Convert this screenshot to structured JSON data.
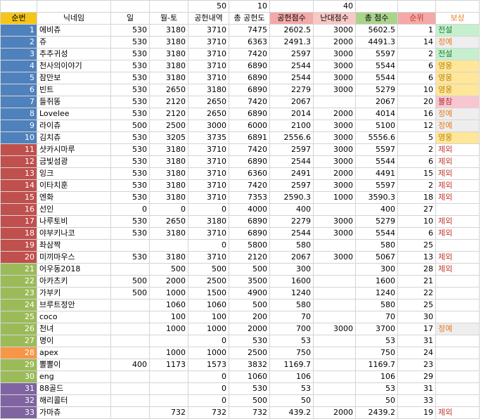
{
  "top_row": [
    "",
    "",
    "",
    "",
    "50",
    "10",
    "",
    "40",
    "",
    "",
    ""
  ],
  "headers": [
    "순번",
    "닉네임",
    "일",
    "월-토",
    "공헌내역",
    "총 공헌도",
    "공헌점수",
    "난대점수",
    "총 점수",
    "순위",
    "보상"
  ],
  "header_colors": [
    "#f5c518",
    "#ffffff",
    "#ffffff",
    "#ffffff",
    "#ffffff",
    "#ffffff",
    "#f4a9a8",
    "#f9c8c4",
    "#a9d48a",
    "#f4a9a8",
    "#ffffff"
  ],
  "header_text_colors": [
    "#000000",
    "#000000",
    "#000000",
    "#000000",
    "#000000",
    "#000000",
    "#000000",
    "#000000",
    "#000000",
    "#c0392b",
    "#e67e22"
  ],
  "rows": [
    {
      "idx": "1",
      "name": "에비츄",
      "c": [
        "530",
        "3180",
        "3710",
        "7475",
        "2602.5",
        "3000",
        "5602.5",
        "1"
      ],
      "reward": "전설",
      "rc": "green",
      "rb": "#c6efce",
      "ic": "#4f81bd"
    },
    {
      "idx": "2",
      "name": "쥬",
      "c": [
        "530",
        "3180",
        "3710",
        "6363",
        "2491.3",
        "2000",
        "4491.3",
        "14"
      ],
      "reward": "정예",
      "rc": "orange",
      "rb": "#eeeeee",
      "ic": "#4f81bd"
    },
    {
      "idx": "3",
      "name": "추추귀성",
      "c": [
        "530",
        "3180",
        "3710",
        "7420",
        "2597",
        "3000",
        "5597",
        "2"
      ],
      "reward": "전설",
      "rc": "green",
      "rb": "#c6efce",
      "ic": "#4f81bd"
    },
    {
      "idx": "4",
      "name": "천사의이야기",
      "c": [
        "530",
        "3180",
        "3710",
        "6890",
        "2544",
        "3000",
        "5544",
        "6"
      ],
      "reward": "영웅",
      "rc": "gold",
      "rb": "#ffe699",
      "ic": "#4f81bd"
    },
    {
      "idx": "5",
      "name": "잠만보",
      "c": [
        "530",
        "3180",
        "3710",
        "6890",
        "2544",
        "3000",
        "5544",
        "6"
      ],
      "reward": "영웅",
      "rc": "gold",
      "rb": "#ffe699",
      "ic": "#4f81bd"
    },
    {
      "idx": "6",
      "name": "빈트",
      "c": [
        "530",
        "2650",
        "3180",
        "6890",
        "2279",
        "3000",
        "5279",
        "10"
      ],
      "reward": "영웅",
      "rc": "gold",
      "rb": "#ffe699",
      "ic": "#4f81bd"
    },
    {
      "idx": "7",
      "name": "들쥐똥",
      "c": [
        "530",
        "2120",
        "2650",
        "7420",
        "2067",
        "",
        "2067",
        "20"
      ],
      "reward": "불참",
      "rc": "dark",
      "rb": "#f8c6d0",
      "ic": "#4f81bd"
    },
    {
      "idx": "8",
      "name": "Lovelee",
      "c": [
        "530",
        "2120",
        "2650",
        "6890",
        "2014",
        "2000",
        "4014",
        "16"
      ],
      "reward": "정예",
      "rc": "orange",
      "rb": "#eeeeee",
      "ic": "#4f81bd"
    },
    {
      "idx": "9",
      "name": "라이츄",
      "c": [
        "500",
        "2500",
        "3000",
        "6000",
        "2100",
        "3000",
        "5100",
        "12"
      ],
      "reward": "정예",
      "rc": "orange",
      "rb": "#eeeeee",
      "ic": "#4f81bd"
    },
    {
      "idx": "10",
      "name": "김치츄",
      "c": [
        "530",
        "3205",
        "3735",
        "6891",
        "2556.6",
        "3000",
        "5556.6",
        "5"
      ],
      "reward": "영웅",
      "rc": "gold",
      "rb": "#ffe699",
      "ic": "#4f81bd"
    },
    {
      "idx": "11",
      "name": "샷카시마루",
      "c": [
        "530",
        "3180",
        "3710",
        "7420",
        "2597",
        "3000",
        "5597",
        "2"
      ],
      "reward": "제외",
      "rc": "red",
      "rb": "#ffffff",
      "ic": "#c0504d"
    },
    {
      "idx": "12",
      "name": "금빛섬광",
      "c": [
        "530",
        "3180",
        "3710",
        "6890",
        "2544",
        "3000",
        "5544",
        "6"
      ],
      "reward": "제외",
      "rc": "red",
      "rb": "#ffffff",
      "ic": "#c0504d"
    },
    {
      "idx": "13",
      "name": "잉크",
      "c": [
        "530",
        "3180",
        "3710",
        "6360",
        "2491",
        "2000",
        "4491",
        "15"
      ],
      "reward": "제외",
      "rc": "red",
      "rb": "#ffffff",
      "ic": "#c0504d"
    },
    {
      "idx": "14",
      "name": "이타치훈",
      "c": [
        "530",
        "3180",
        "3710",
        "7420",
        "2597",
        "3000",
        "5597",
        "2"
      ],
      "reward": "제외",
      "rc": "red",
      "rb": "#ffffff",
      "ic": "#c0504d"
    },
    {
      "idx": "15",
      "name": "엔화",
      "c": [
        "530",
        "3180",
        "3710",
        "7353",
        "2590.3",
        "1000",
        "3590.3",
        "18"
      ],
      "reward": "제외",
      "rc": "red",
      "rb": "#ffffff",
      "ic": "#c0504d"
    },
    {
      "idx": "16",
      "name": "선인",
      "c": [
        "0",
        "0",
        "0",
        "4000",
        "400",
        "",
        "400",
        "27"
      ],
      "reward": "",
      "rc": "red",
      "rb": "#ffffff",
      "ic": "#c0504d"
    },
    {
      "idx": "17",
      "name": "나루토비",
      "c": [
        "530",
        "2650",
        "3180",
        "6890",
        "2279",
        "3000",
        "5279",
        "10"
      ],
      "reward": "제외",
      "rc": "red",
      "rb": "#ffffff",
      "ic": "#c0504d"
    },
    {
      "idx": "18",
      "name": "야부키나코",
      "c": [
        "530",
        "3180",
        "3710",
        "6890",
        "2544",
        "3000",
        "5544",
        "6"
      ],
      "reward": "제외",
      "rc": "red",
      "rb": "#ffffff",
      "ic": "#c0504d"
    },
    {
      "idx": "19",
      "name": "좌삼짝",
      "c": [
        "",
        "",
        "0",
        "5800",
        "580",
        "",
        "580",
        "25"
      ],
      "reward": "",
      "rc": "red",
      "rb": "#ffffff",
      "ic": "#c0504d"
    },
    {
      "idx": "20",
      "name": "미끼마우스",
      "c": [
        "530",
        "3180",
        "3710",
        "2120",
        "2067",
        "3000",
        "5067",
        "13"
      ],
      "reward": "제외",
      "rc": "red",
      "rb": "#ffffff",
      "ic": "#c0504d"
    },
    {
      "idx": "21",
      "name": "어우동2018",
      "c": [
        "",
        "500",
        "500",
        "500",
        "300",
        "",
        "300",
        "28"
      ],
      "reward": "제외",
      "rc": "red",
      "rb": "#ffffff",
      "ic": "#9bbb59"
    },
    {
      "idx": "22",
      "name": "아카츠키",
      "c": [
        "500",
        "2000",
        "2500",
        "3500",
        "1600",
        "",
        "1600",
        "21"
      ],
      "reward": "",
      "rc": "red",
      "rb": "#ffffff",
      "ic": "#9bbb59"
    },
    {
      "idx": "23",
      "name": "가부키",
      "c": [
        "500",
        "1000",
        "1500",
        "4900",
        "1240",
        "",
        "1240",
        "22"
      ],
      "reward": "",
      "rc": "red",
      "rb": "#ffffff",
      "ic": "#9bbb59"
    },
    {
      "idx": "24",
      "name": "브루트정안",
      "c": [
        "",
        "1060",
        "1060",
        "500",
        "580",
        "",
        "580",
        "25"
      ],
      "reward": "",
      "rc": "red",
      "rb": "#ffffff",
      "ic": "#9bbb59"
    },
    {
      "idx": "25",
      "name": "coco",
      "c": [
        "",
        "100",
        "100",
        "200",
        "70",
        "",
        "70",
        "30"
      ],
      "reward": "",
      "rc": "red",
      "rb": "#ffffff",
      "ic": "#9bbb59"
    },
    {
      "idx": "26",
      "name": "천녀",
      "c": [
        "",
        "1000",
        "1000",
        "2000",
        "700",
        "3000",
        "3700",
        "17"
      ],
      "reward": "정예",
      "rc": "orange",
      "rb": "#eeeeee",
      "ic": "#9bbb59"
    },
    {
      "idx": "27",
      "name": "명이",
      "c": [
        "",
        "",
        "0",
        "530",
        "53",
        "",
        "53",
        "31"
      ],
      "reward": "",
      "rc": "red",
      "rb": "#ffffff",
      "ic": "#9bbb59"
    },
    {
      "idx": "28",
      "name": "apex",
      "c": [
        "",
        "1000",
        "1000",
        "2500",
        "750",
        "",
        "750",
        "24"
      ],
      "reward": "",
      "rc": "red",
      "rb": "#ffffff",
      "ic": "#f79646"
    },
    {
      "idx": "29",
      "name": "뽈뽈이",
      "c": [
        "400",
        "1173",
        "1573",
        "3832",
        "1169.7",
        "",
        "1169.7",
        "23"
      ],
      "reward": "",
      "rc": "red",
      "rb": "#ffffff",
      "ic": "#9bbb59"
    },
    {
      "idx": "30",
      "name": "eng",
      "c": [
        "",
        "",
        "0",
        "1060",
        "106",
        "",
        "106",
        "29"
      ],
      "reward": "",
      "rc": "red",
      "rb": "#ffffff",
      "ic": "#9bbb59"
    },
    {
      "idx": "31",
      "name": "88골드",
      "c": [
        "",
        "",
        "0",
        "530",
        "53",
        "",
        "53",
        "31"
      ],
      "reward": "",
      "rc": "red",
      "rb": "#ffffff",
      "ic": "#8064a2"
    },
    {
      "idx": "32",
      "name": "해리콜터",
      "c": [
        "",
        "",
        "0",
        "500",
        "50",
        "",
        "50",
        "33"
      ],
      "reward": "",
      "rc": "red",
      "rb": "#ffffff",
      "ic": "#8064a2"
    },
    {
      "idx": "33",
      "name": "가마츄",
      "c": [
        "",
        "732",
        "732",
        "732",
        "439.2",
        "2000",
        "2439.2",
        "19"
      ],
      "reward": "제외",
      "rc": "red",
      "rb": "#ffffff",
      "ic": "#8064a2"
    }
  ]
}
